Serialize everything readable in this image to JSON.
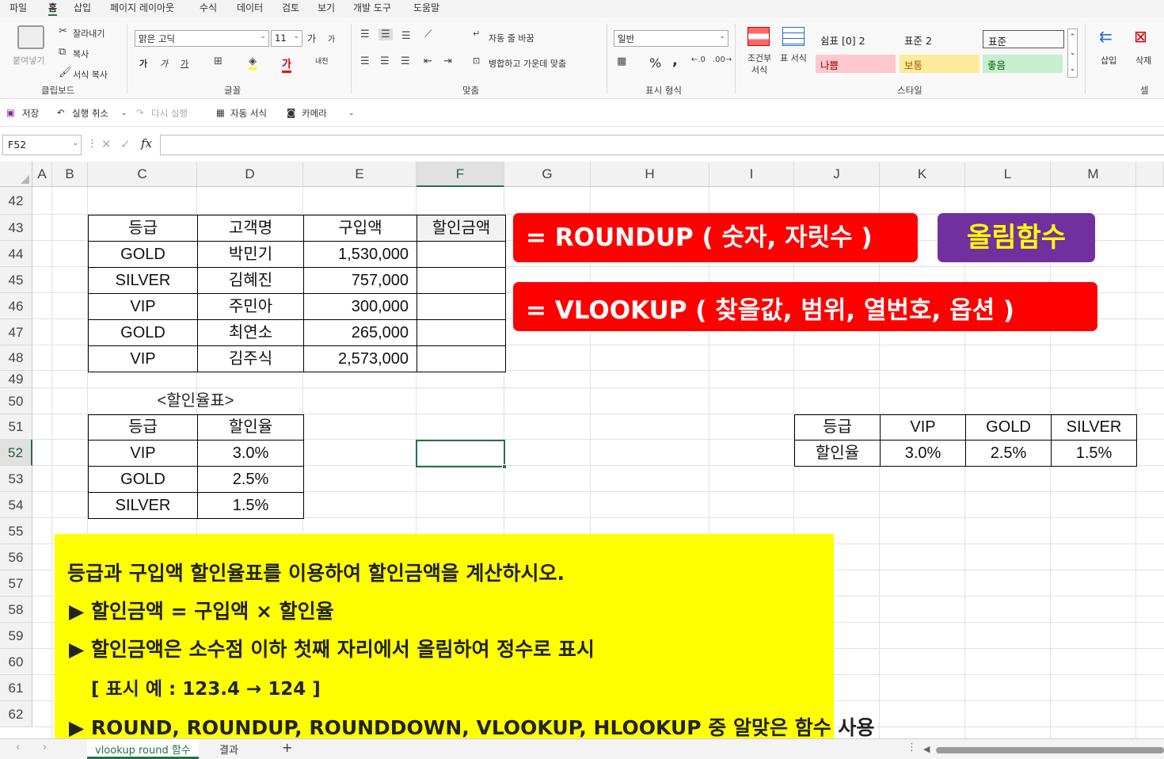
{
  "menu": [
    "파일",
    "홈",
    "삽입",
    "페이지 레이아웃",
    "수식",
    "데이터",
    "검토",
    "보기",
    "개발 도구",
    "도움말"
  ],
  "ribbon": {
    "clipboard": {
      "paste": "붙여넣기",
      "cut": "잘라내기",
      "copy": "복사",
      "format_painter": "서식 복사",
      "label": "클립보드"
    },
    "font": {
      "name": "맑은 고딕",
      "size": "11",
      "label": "글꼴",
      "grow": "가",
      "shrink": "가",
      "bold": "가",
      "italic": "가",
      "underline": "가",
      "font_color_glyph": "가",
      "phonetic": "내천"
    },
    "alignment": {
      "wrap": "자동 줄 바꿈",
      "merge": "병합하고 가운데 맞춤",
      "label": "맞춤"
    },
    "number": {
      "format": "일반",
      "label": "표시 형식",
      "percent": "%",
      "comma": ","
    },
    "styles": {
      "conditional": "조건부 서식",
      "table": "표 서식",
      "label": "스타일",
      "cells": [
        {
          "text": "쉼표 [0] 2",
          "bg": "#ffffff"
        },
        {
          "text": "표준 2",
          "bg": "#ffffff"
        },
        {
          "text": "표준",
          "bg": "#ffffff"
        },
        {
          "text": "나쁨",
          "bg": "#ffc7ce",
          "color": "#9c0006"
        },
        {
          "text": "보통",
          "bg": "#ffeb9c",
          "color": "#9c5700"
        },
        {
          "text": "좋음",
          "bg": "#c6efce",
          "color": "#006100"
        }
      ]
    },
    "cells_group": {
      "insert": "삽입",
      "delete": "삭제",
      "label": "셀"
    }
  },
  "qat": {
    "save": "저장",
    "undo": "실행 취소",
    "redo": "다시 실행",
    "autoformat": "자동 서식",
    "camera": "카메라"
  },
  "formula_bar": {
    "namebox": "F52",
    "fx": "fx",
    "value": ""
  },
  "columns": [
    "A",
    "B",
    "C",
    "D",
    "E",
    "F",
    "G",
    "H",
    "I",
    "J",
    "K",
    "L",
    "M"
  ],
  "rows": [
    "42",
    "43",
    "44",
    "45",
    "46",
    "47",
    "48",
    "49",
    "50",
    "51",
    "52",
    "53",
    "54",
    "55",
    "56",
    "57",
    "58",
    "59",
    "60",
    "61",
    "62"
  ],
  "selected_cell": "F52",
  "main_table": {
    "headers": [
      "등급",
      "고객명",
      "구입액",
      "할인금액"
    ],
    "rows": [
      [
        "GOLD",
        "박민기",
        "1,530,000",
        ""
      ],
      [
        "SILVER",
        "김혜진",
        "757,000",
        ""
      ],
      [
        "VIP",
        "주민아",
        "300,000",
        ""
      ],
      [
        "GOLD",
        "최연소",
        "265,000",
        ""
      ],
      [
        "VIP",
        "김주식",
        "2,573,000",
        ""
      ]
    ]
  },
  "rate_table": {
    "title": "<할인율표>",
    "headers": [
      "등급",
      "할인율"
    ],
    "rows": [
      [
        "VIP",
        "3.0%"
      ],
      [
        "GOLD",
        "2.5%"
      ],
      [
        "SILVER",
        "1.5%"
      ]
    ]
  },
  "h_table": {
    "row1": [
      "등급",
      "VIP",
      "GOLD",
      "SILVER"
    ],
    "row2": [
      "할인율",
      "3.0%",
      "2.5%",
      "1.5%"
    ]
  },
  "banners": {
    "roundup": "= ROUNDUP ( 숫자, 자릿수 )",
    "roundup_tag": "올림함수",
    "vlookup": "= VLOOKUP ( 찾을값, 범위, 열번호, 옵션 )",
    "red": "#ff0000",
    "purple": "#7030a0",
    "tag_text": "#ffff00"
  },
  "instructions": {
    "bg": "#ffff00",
    "lines": [
      "등급과 구입액 할인율표를 이용하여 할인금액을 계산하시오.",
      "▶ 할인금액 = 구입액 × 할인율",
      "▶ 할인금액은 소수점 이하 첫째 자리에서 올림하여 정수로 표시",
      "[ 표시 예 : 123.4  →  124 ]",
      "▶ ROUND, ROUNDUP, ROUNDDOWN, VLOOKUP, HLOOKUP 중 알맞은 함수 사용"
    ]
  },
  "sheet_tabs": [
    "vlookup round 함수",
    "결과"
  ],
  "add_sheet": "+"
}
